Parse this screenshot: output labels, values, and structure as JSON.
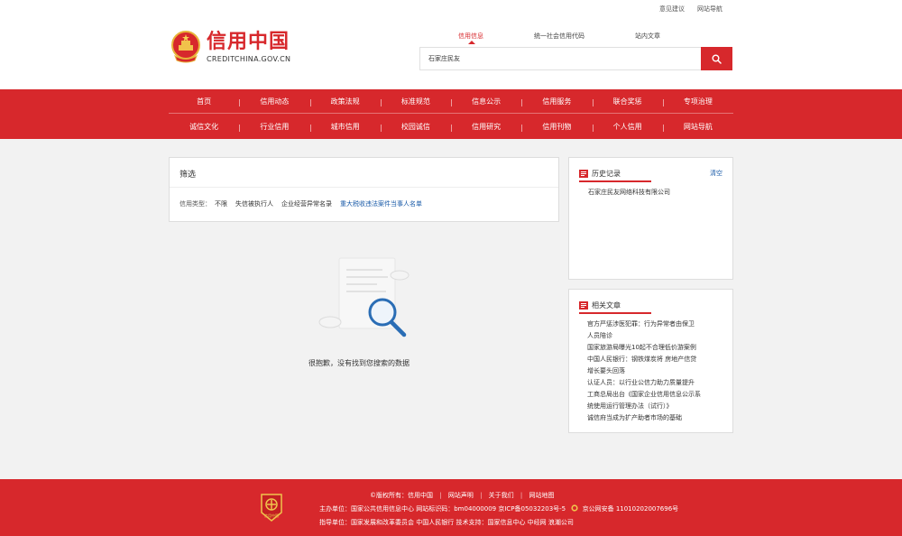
{
  "header": {
    "top_links": [
      "意见建议",
      "网站导航"
    ],
    "logo_cn": "信用中国",
    "logo_en": "CREDITCHINA.GOV.CN"
  },
  "search": {
    "tabs": [
      "信用信息",
      "统一社会信用代码",
      "站内文章"
    ],
    "active_tab": "信用信息",
    "value": "石家庄民友"
  },
  "nav": {
    "row1": [
      "首页",
      "信用动态",
      "政策法规",
      "标准规范",
      "信息公示",
      "信用服务",
      "联合奖惩",
      "专项治理"
    ],
    "row2": [
      "诚信文化",
      "行业信用",
      "城市信用",
      "校园诚信",
      "信用研究",
      "信用刊物",
      "个人信用",
      "网站导航"
    ]
  },
  "filter": {
    "title": "筛选",
    "label": "信用类型：",
    "options": [
      "不限",
      "失信被执行人",
      "企业经营异常名录",
      "重大税收违法案件当事人名单"
    ]
  },
  "empty": {
    "message": "很抱歉，没有找到您搜索的数据"
  },
  "history": {
    "title": "历史记录",
    "clear": "清空",
    "items": [
      "石家庄民友网络科技有限公司"
    ]
  },
  "related": {
    "title": "相关文章",
    "lines": [
      "官方严惩涉医犯罪：行为异常者由保卫",
      "人员陪诊",
      "国家旅游局曝光10起不合理低价游案例",
      "中国人民银行：钢铁煤炭将 房地产信贷",
      "增长要头回落",
      "认证人员：以行业公信力助力质量提升",
      "工商总局出台《国家企业信用信息公示系",
      "统使用运行管理办法（试行）》",
      "诚信府当成为扩产助者市场的基础"
    ]
  },
  "footer": {
    "copyright": "©版权所有：信用中国",
    "links": [
      "网站声明",
      "关于我们",
      "网站地图"
    ],
    "line2": "主办单位：国家公共信用信息中心  网站标识码：bm04000009  京ICP备05032203号-5",
    "police": "京公网安备 11010202007696号",
    "line3": "指导单位：国家发展和改革委员会 中国人民银行  技术支持：国家信息中心 中经网 浪潮公司",
    "badge": "信用中国"
  },
  "colors": {
    "brand_red": "#d7282c",
    "link_blue": "#1a5ba8"
  }
}
